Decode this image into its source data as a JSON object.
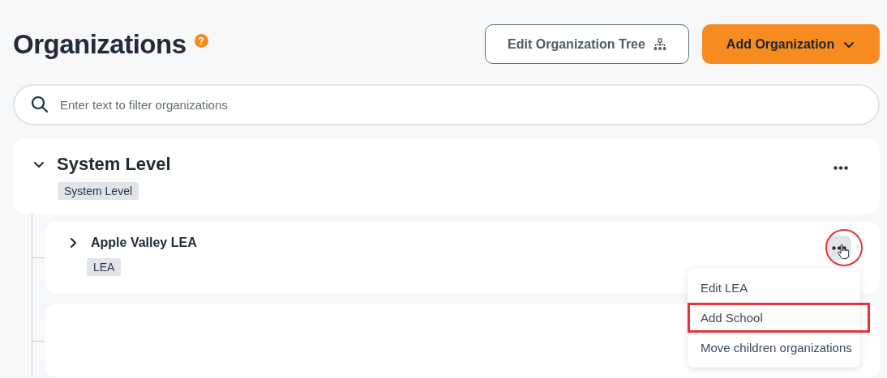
{
  "header": {
    "title": "Organizations",
    "help_icon": "?"
  },
  "buttons": [
    {
      "label": "Edit Organization Tree",
      "kind": "outline"
    },
    {
      "label": "Add Organization",
      "kind": "primary"
    }
  ],
  "search": {
    "placeholder": "Enter text to filter organizations"
  },
  "tree": [
    {
      "kind": "node",
      "name": "System Level",
      "tag": "System Level",
      "expanded": true,
      "menu_open": false,
      "children": [
        {
          "kind": "node",
          "name": "Apple Valley LEA",
          "tag": "LEA",
          "expanded": false,
          "menu_open": true,
          "annotated": true,
          "menu": [
            {
              "label": "Edit LEA",
              "annotated": false
            },
            {
              "label": "Add School",
              "annotated": true
            },
            {
              "label": "Move children organizations",
              "annotated": false
            }
          ]
        },
        {
          "kind": "blank"
        }
      ]
    }
  ]
}
